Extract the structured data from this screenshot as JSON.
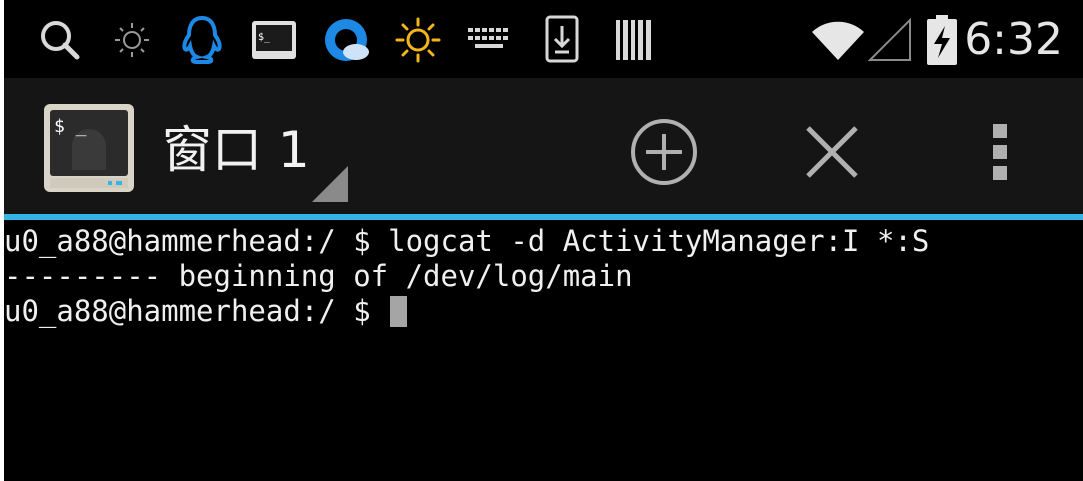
{
  "status_bar": {
    "left_icons": [
      "search-icon",
      "brightness-icon",
      "qq-penguin-icon",
      "terminal-app-icon",
      "browser-c-icon",
      "sun-icon",
      "keyboard-icon",
      "download-icon",
      "barcode-icon"
    ],
    "right_icons": [
      "wifi-icon",
      "cell-signal-icon",
      "battery-charging-icon"
    ],
    "time": "6:32"
  },
  "action_bar": {
    "app_icon": "terminal-app-icon",
    "window_title": "窗口 1",
    "buttons": [
      "new-window-button",
      "close-window-button",
      "overflow-menu-button"
    ],
    "accent_color": "#33b5e5"
  },
  "terminal": {
    "lines": [
      "u0_a88@hammerhead:/ $ logcat -d ActivityManager:I *:S",
      "--------- beginning of /dev/log/main",
      "u0_a88@hammerhead:/ $ "
    ]
  }
}
